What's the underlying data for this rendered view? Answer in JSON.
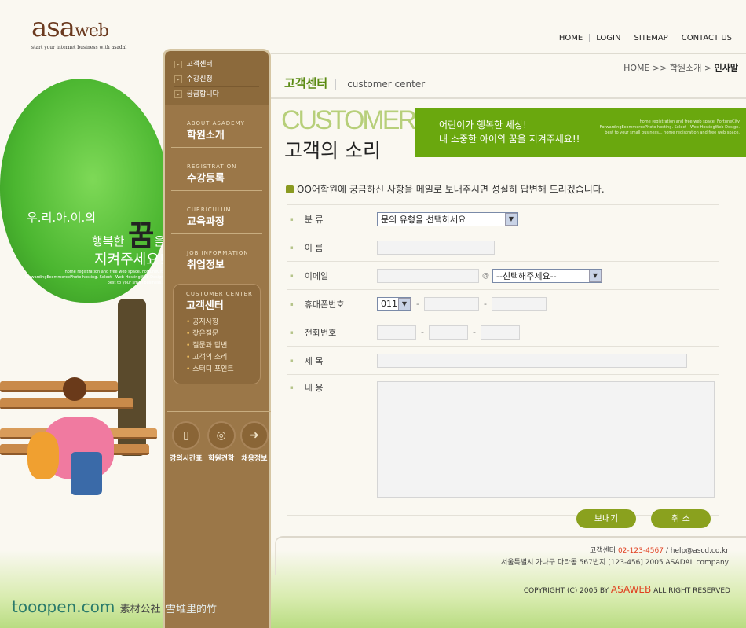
{
  "logo": {
    "main": "asa",
    "sub": "web",
    "tagline": "start your internet business with asadal"
  },
  "topnav": [
    "HOME",
    "LOGIN",
    "SITEMAP",
    "CONTACT US"
  ],
  "illustration": {
    "line1": "우.리.아.이.의",
    "line2a": "행복한",
    "big": "꿈",
    "line2b": "을",
    "line3": "지켜주세요!",
    "small": "home registration and free web space. FortuneCity ForwardingEcommercePhoto hosting. Select --Web HostingWeb Design. best to your small business..."
  },
  "watermark": {
    "site": "tooopen.com",
    "cn": "素材公社",
    "extra": "雪堆里的竹"
  },
  "sidebar": {
    "submenu": [
      "고객센터",
      "수강신청",
      "궁금합니다"
    ],
    "menu": [
      {
        "en": "ABOUT ASADEMY",
        "ko": "학원소개"
      },
      {
        "en": "REGISTRATION",
        "ko": "수강등록"
      },
      {
        "en": "CURRICULUM",
        "ko": "교육과정"
      },
      {
        "en": "JOB INFORMATION",
        "ko": "취업정보"
      }
    ],
    "customer": {
      "en": "CUSTOMER CENTER",
      "ko": "고객센터",
      "items": [
        "공지사항",
        "잦은질문",
        "질문과 답변",
        "고객의 소리",
        "스터디 포인트"
      ]
    },
    "quick": [
      "강의시간표",
      "학원견학",
      "채용정보"
    ]
  },
  "breadcrumb": {
    "home": "HOME >> 학원소개 > ",
    "current": "인사말"
  },
  "page": {
    "title": "고객센터",
    "subtitle": "customer center",
    "big_en": "CUSTOMER",
    "big_ko": "고객의 소리"
  },
  "banner": {
    "line1": "어린이가 행복한 세상!",
    "line2": "내 소중한 아이의 꿈을 지켜주세요!!",
    "small": "home registration and free web space. FortuneCity ForwardingEcommercePhoto hosting. Select --Web HostingWeb Design. best to your small business... home registration and free web space."
  },
  "intro": "OO어학원에 궁금하신 사항을 메일로 보내주시면 성실히 답변해 드리겠습니다.",
  "form": {
    "category": {
      "label": "분  류",
      "value": "문의 유형을 선택하세요"
    },
    "name": {
      "label": "이  름"
    },
    "email": {
      "label": "이메일",
      "at": "@",
      "domain": "--선택해주세요--"
    },
    "mobile": {
      "label": "휴대폰번호",
      "prefix": "011",
      "dash": "-"
    },
    "phone": {
      "label": "전화번호"
    },
    "subject": {
      "label": "제  목"
    },
    "content": {
      "label": "내  용"
    }
  },
  "buttons": {
    "send": "보내기",
    "cancel": "취 소"
  },
  "footer": {
    "center": "고객센터 ",
    "phone": "02-123-4567",
    "email": " / help@ascd.co.kr",
    "address": "서울특별시 가나구 다라동 567번지 [123-456] 2005 ASADAL company",
    "copy_pre": "COPYRIGHT (C) 2005 BY ",
    "copy_brand": "ASAWEB",
    "copy_post": " ALL RIGHT RESERVED"
  },
  "colors": {
    "accent": "#6aa80e",
    "sidebar": "#9b7748",
    "button": "#8aa11e",
    "highlight": "#e04020"
  }
}
